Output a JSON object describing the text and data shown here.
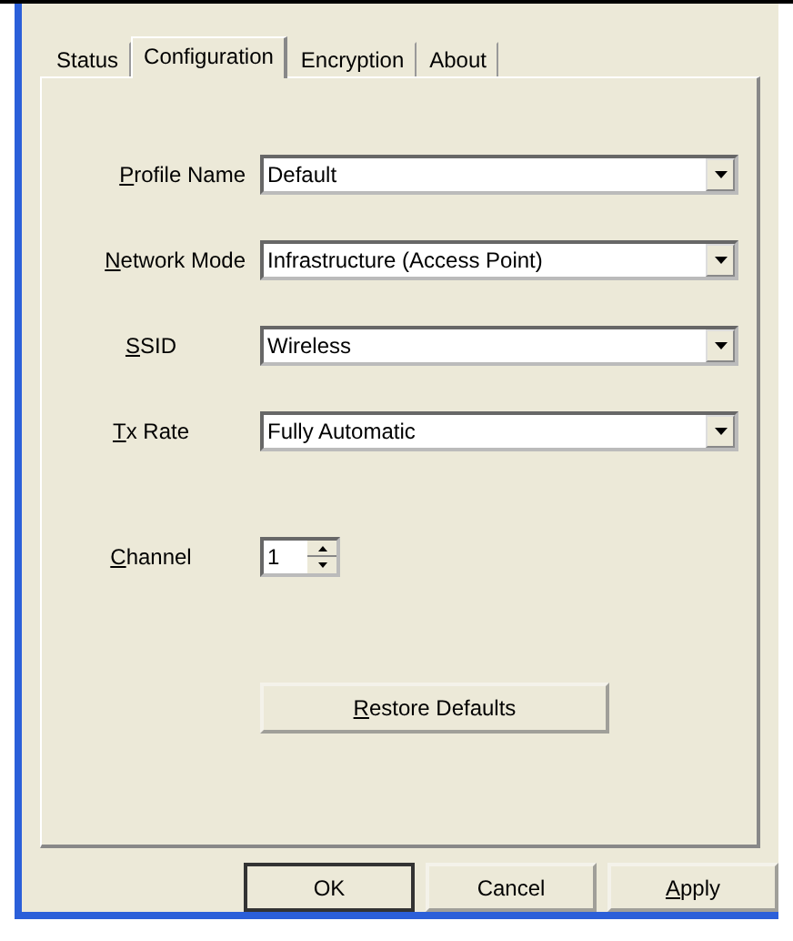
{
  "tabs": [
    {
      "label": "Status",
      "selected": false
    },
    {
      "label": "Configuration",
      "selected": true
    },
    {
      "label": "Encryption",
      "selected": false
    },
    {
      "label": "About",
      "selected": false
    }
  ],
  "fields": [
    {
      "kind": "combo",
      "label": "Profile Name",
      "underline_first": true,
      "value": "Default"
    },
    {
      "kind": "combo",
      "label": "Network Mode",
      "underline_first": true,
      "value": "Infrastructure (Access Point)"
    },
    {
      "kind": "combo",
      "label": "SSID",
      "underline_first": true,
      "value": "Wireless"
    },
    {
      "kind": "combo",
      "label": "Tx Rate",
      "underline_first": true,
      "value": "Fully Automatic"
    },
    {
      "kind": "spin",
      "label": "Channel",
      "underline_first": true,
      "value": "1"
    }
  ],
  "restore_button": {
    "label": "Restore Defaults",
    "underline_first": true
  },
  "buttons": [
    {
      "label": "OK",
      "underline_first": false,
      "default": true
    },
    {
      "label": "Cancel",
      "underline_first": false,
      "default": false
    },
    {
      "label": "Apply",
      "underline_first": true,
      "default": false
    }
  ]
}
